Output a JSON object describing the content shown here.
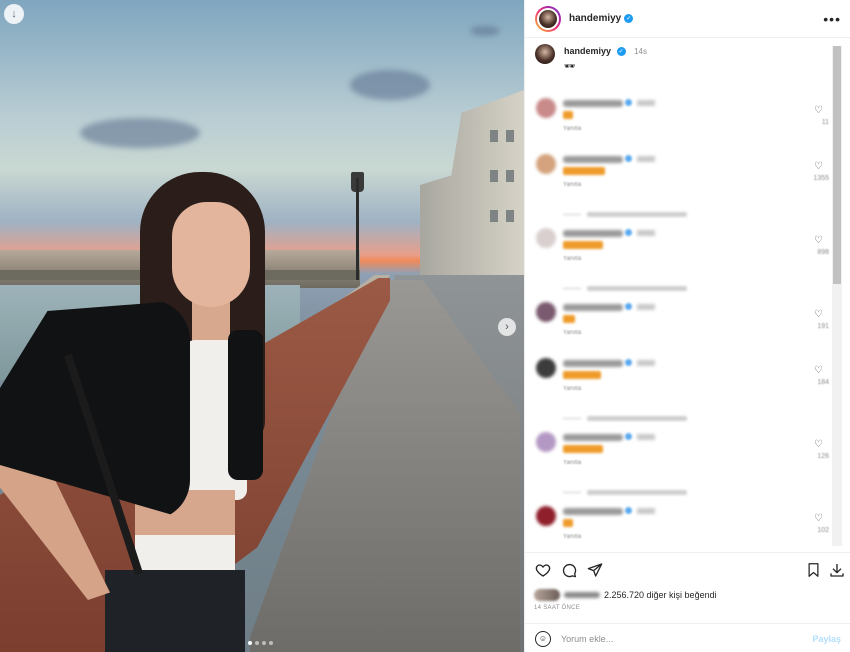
{
  "photo": {
    "save_icon": "download-arrow-icon",
    "next_icon": "chevron-right-icon",
    "carousel_dots": 4,
    "active_dot_index": 0
  },
  "header": {
    "username": "handemiyy",
    "verified": true,
    "more_icon": "more-horizontal-icon",
    "more_label": "•••"
  },
  "caption": {
    "username": "handemiyy",
    "time": "14s",
    "text": "🕶"
  },
  "comments": [
    {
      "emoji": "",
      "likes": "11",
      "reply_label": "Yanıtla",
      "avatar_color": "#c98a8a",
      "text_width": 10
    },
    {
      "emoji": "",
      "likes": "1355",
      "reply_label": "Yanıtla",
      "avatar_color": "#d4a37d",
      "text_width": 42
    },
    {
      "emoji": "",
      "likes": "898",
      "reply_label": "Yanıtla",
      "avatar_color": "#d9cfcf",
      "text_width": 40
    },
    {
      "emoji": "",
      "likes": "191",
      "reply_label": "Yanıtla",
      "avatar_color": "#7a5a6e",
      "text_width": 12
    },
    {
      "emoji": "",
      "likes": "184",
      "reply_label": "Yanıtla",
      "avatar_color": "#3c3c3c",
      "text_width": 38
    },
    {
      "emoji": "",
      "likes": "126",
      "reply_label": "Yanıtla",
      "avatar_color": "#b498c4",
      "text_width": 40
    },
    {
      "emoji": "",
      "likes": "102",
      "reply_label": "Yanıtla",
      "avatar_color": "#8e1f2b",
      "text_width": 10
    }
  ],
  "actions": {
    "like_icon": "heart-icon",
    "comment_icon": "comment-bubble-icon",
    "share_icon": "paper-plane-icon",
    "bookmark_icon": "bookmark-icon",
    "download_icon": "download-icon",
    "likes_text": "2.256.720 diğer kişi beğendi",
    "time_ago": "14 SAAT ÖNCE"
  },
  "comment_box": {
    "emoji_icon": "smiley-icon",
    "placeholder": "Yorum ekle...",
    "post_label": "Paylaş"
  },
  "colors": {
    "verified": "#1d9bf0",
    "post_button": "#b2dffc",
    "text": "#262626",
    "muted": "#8e8e8e"
  }
}
